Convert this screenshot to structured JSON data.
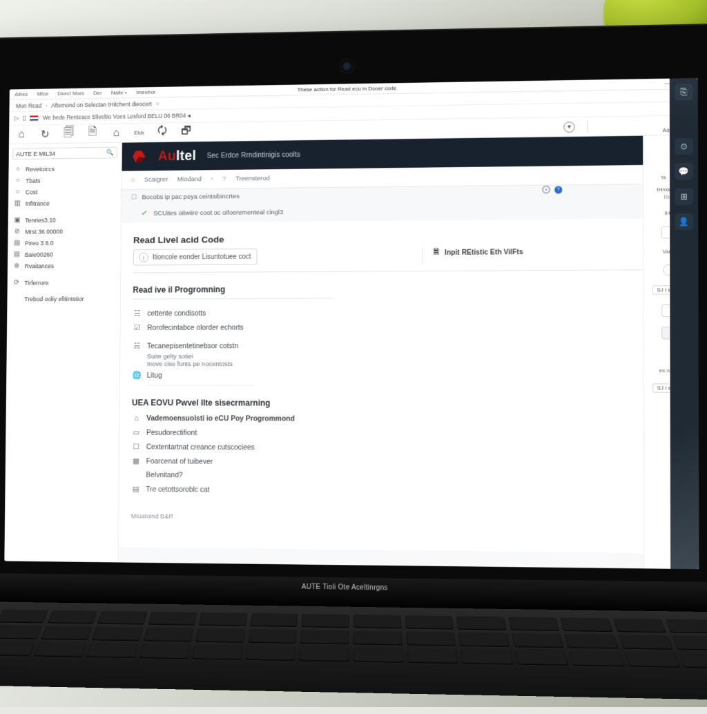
{
  "window": {
    "title": "These action for Read ecu in Dooer code",
    "min": "—",
    "max": "▢",
    "close": "✕",
    "addAction": "Add e-Host"
  },
  "menus": {
    "m1": "Albes",
    "m2": "Mfce",
    "m3": "Dkect Mars",
    "m4": "Der",
    "m5": "Naite •",
    "m6": "Imeebor"
  },
  "breadcrumb": {
    "b1": "Mon Read",
    "sep1": "›",
    "b2": "Aftemond on Selectan tHitchent dieocert",
    "sep2": "˅"
  },
  "address": {
    "icon1": "▷",
    "icon2": "▯",
    "text": "We bede Renteace Bliveltio Voes Lesford BELU 06 BR04 ◂"
  },
  "toolbar": {
    "t1": "⌂",
    "t2": "↻",
    "t3": "🗐",
    "t4": "🗎",
    "t5": "⌂",
    "t6": "Elck",
    "t7": "🗘",
    "t8": "🗗",
    "target": "⌖",
    "add": "Add e-Host",
    "closex": "✕"
  },
  "search": {
    "value": "AUTE E MIL34",
    "icon": "🔍"
  },
  "sidebar": {
    "items": [
      {
        "g": "○",
        "label": "Revetoiccs"
      },
      {
        "g": "○",
        "label": "Tbats"
      },
      {
        "g": "○",
        "label": "Cost"
      },
      {
        "g": "▥",
        "label": "Infitrance"
      }
    ],
    "group2": [
      {
        "g": "▣",
        "label": "Tenries3.10"
      },
      {
        "g": "⊘",
        "label": "Mrst 36 00000"
      },
      {
        "g": "▤",
        "label": "Pireo 3 8.0"
      },
      {
        "g": "▤",
        "label": "Baie00260"
      },
      {
        "g": "⊛",
        "label": "Rvaitances"
      }
    ],
    "group3": [
      {
        "g": "⟳",
        "label": "Tirferrore"
      }
    ],
    "group4": [
      {
        "g": "",
        "label": "Trebod ooliy efitintstior"
      }
    ]
  },
  "app": {
    "brandA": "Au",
    "brandB": "ltel",
    "subtitle": "Sec Erdce Rrndintinigis coolts",
    "tabs": {
      "home": "⌂",
      "t1": "Scaigrer",
      "t2": "Miodand",
      "dot": "•",
      "t3": "Treensterod"
    },
    "starIcon": "✧",
    "info1": "Bocobs ip pac peya ceintsibincrtes",
    "info2": "SCUites oitwiire coot oc oifoerementeal cingl3",
    "indicatorHelp": "?",
    "heading1": "Read Livel acid Code",
    "chip1": "Itioncole eonder Lisuntotuee coct",
    "colBTitle": "Inpit REtistic Eth VilFts",
    "heading2": "Read ive il Progromning",
    "list2": [
      {
        "g": "☵",
        "label": "cettente condisotts"
      },
      {
        "g": "☑",
        "label": "Rorofecintabce olorder echorts"
      },
      {
        "g": "☵",
        "label": "Tecanepisentetinebsor cotstn"
      }
    ],
    "subA": "Suite gelty sotiei",
    "subB": "Inove cise funts pe nocentosts",
    "linkRow": "Litug",
    "heading3": "UEA EOVU Pwvel Ilte sisecrmarning",
    "list3": [
      {
        "g": "⌂",
        "label": "Vademoensuolsti io eCU Poy Progrommond"
      },
      {
        "g": "▭",
        "label": "Pesudorectifiont"
      },
      {
        "g": "☐",
        "label": "Cextentartnat creance cutscociees"
      },
      {
        "g": "▦",
        "label": "Foarcenat of tuibever"
      },
      {
        "g": "",
        "label": "Belvnitand?"
      },
      {
        "g": "▤",
        "label": "Tre cetottsoroblc cat"
      }
    ],
    "footer": "Mioatoind B&R",
    "rightTags": {
      "a": "IH/os CA",
      "b": "Rtit"
    }
  },
  "rightPanel": {
    "items": [
      {
        "txt": "IHt"
      },
      {
        "txt": ""
      },
      {
        "txt": "Varc"
      },
      {
        "txt": ""
      },
      {
        "txt": ""
      },
      {
        "txt": ""
      }
    ],
    "btn": "SJ i sfesl",
    "tag2": "es noid"
  },
  "hinge": "AUTE Tioli Ote Aceltinrgns",
  "farRail": {
    "a": "⎘",
    "b": "⊙",
    "c": "💬",
    "d": "⊞",
    "e": "👤"
  }
}
